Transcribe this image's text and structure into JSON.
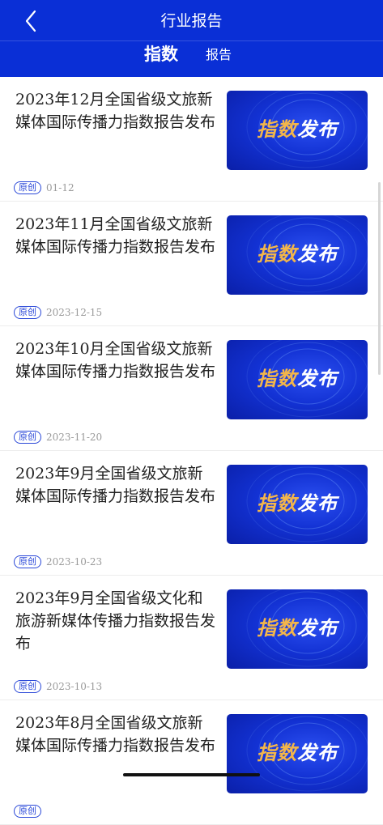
{
  "header": {
    "title": "行业报告",
    "back_icon": "chevron-left-icon"
  },
  "tabs": [
    {
      "label": "指数",
      "active": true
    },
    {
      "label": "报告",
      "active": false
    }
  ],
  "colors": {
    "brand": "#0a2fd6",
    "badge": "#2a48d8",
    "thumb_accent": "#f3b64a"
  },
  "articles": [
    {
      "title": "2023年12月全国省级文旅新媒体国际传播力指数报告发布",
      "badge": "原创",
      "date": "01-12",
      "thumb_a": "指数",
      "thumb_b": "发布"
    },
    {
      "title": "2023年11月全国省级文旅新媒体国际传播力指数报告发布",
      "badge": "原创",
      "date": "2023-12-15",
      "thumb_a": "指数",
      "thumb_b": "发布"
    },
    {
      "title": "2023年10月全国省级文旅新媒体国际传播力指数报告发布",
      "badge": "原创",
      "date": "2023-11-20",
      "thumb_a": "指数",
      "thumb_b": "发布"
    },
    {
      "title": "2023年9月全国省级文旅新媒体国际传播力指数报告发布",
      "badge": "原创",
      "date": "2023-10-23",
      "thumb_a": "指数",
      "thumb_b": "发布"
    },
    {
      "title": "2023年9月全国省级文化和旅游新媒体传播力指数报告发布",
      "badge": "原创",
      "date": "2023-10-13",
      "thumb_a": "指数",
      "thumb_b": "发布"
    },
    {
      "title": "2023年8月全国省级文旅新媒体国际传播力指数报告发布",
      "badge": "原创",
      "date": "",
      "thumb_a": "指数",
      "thumb_b": "发布"
    }
  ]
}
